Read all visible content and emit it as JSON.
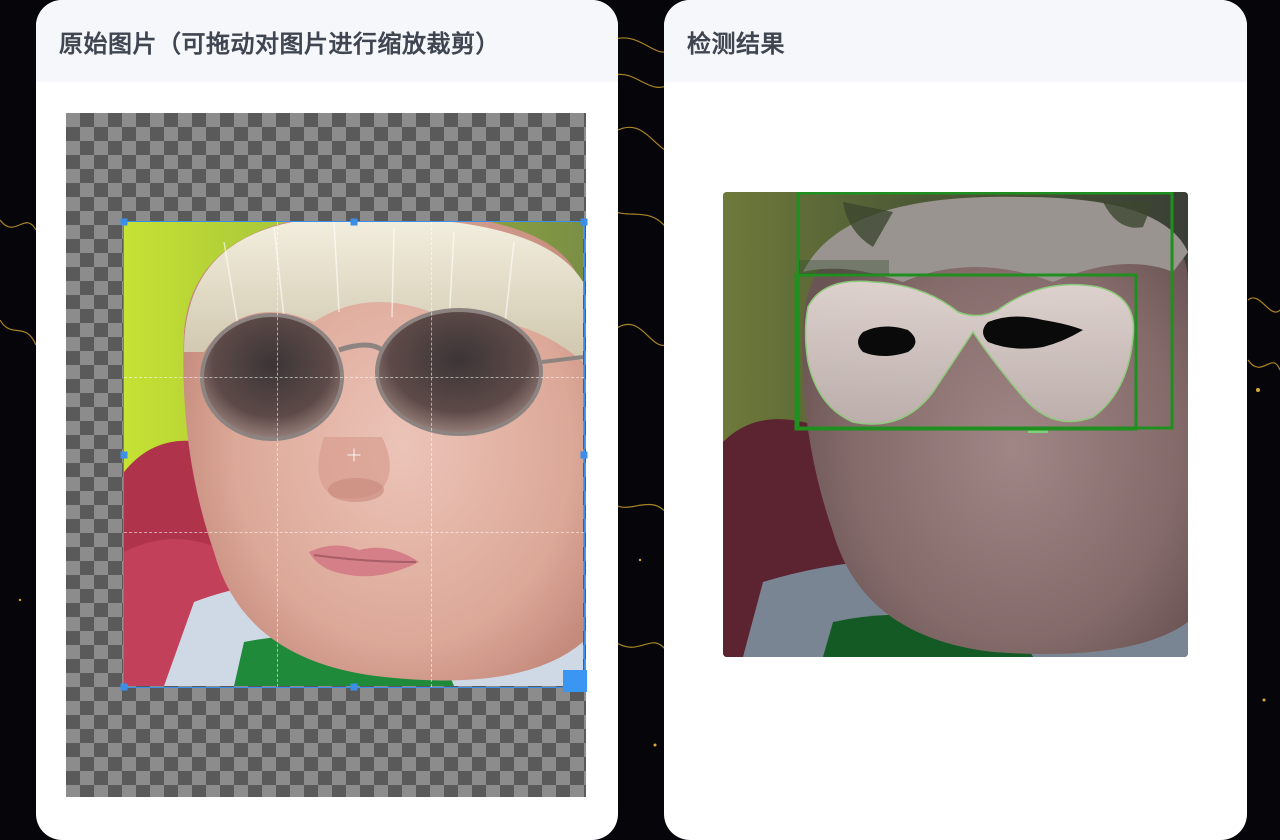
{
  "left_panel": {
    "title": "原始图片（可拖动对图片进行缩放裁剪）"
  },
  "right_panel": {
    "title": "检测结果"
  },
  "colors": {
    "crop_accent": "#3b8fe8",
    "detection_box": "#1f8f1f"
  }
}
